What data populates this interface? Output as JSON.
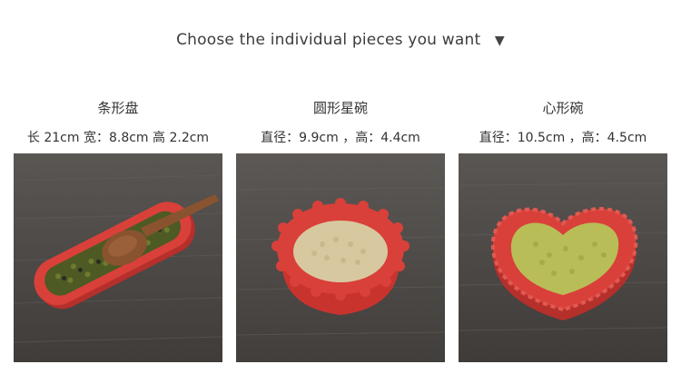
{
  "header": {
    "title": "Choose the individual pieces you want",
    "arrow_icon": "triangle-down-icon"
  },
  "products": [
    {
      "name": "条形盘",
      "dims": "长 21cm 宽：8.8cm 高 2.2cm"
    },
    {
      "name": "圆形星碗",
      "dims": "直径：9.9cm ，高：4.4cm"
    },
    {
      "name": "心形碗",
      "dims": "直径：10.5cm ，高：4.5cm"
    }
  ],
  "colors": {
    "dish_red": "#d9403a",
    "wood_table": "#4e4b48",
    "beans_green": "#6f7a2f",
    "rice_beige": "#d8c8a0",
    "lentil_green": "#b9bd57",
    "spoon_wood": "#8a5330"
  }
}
